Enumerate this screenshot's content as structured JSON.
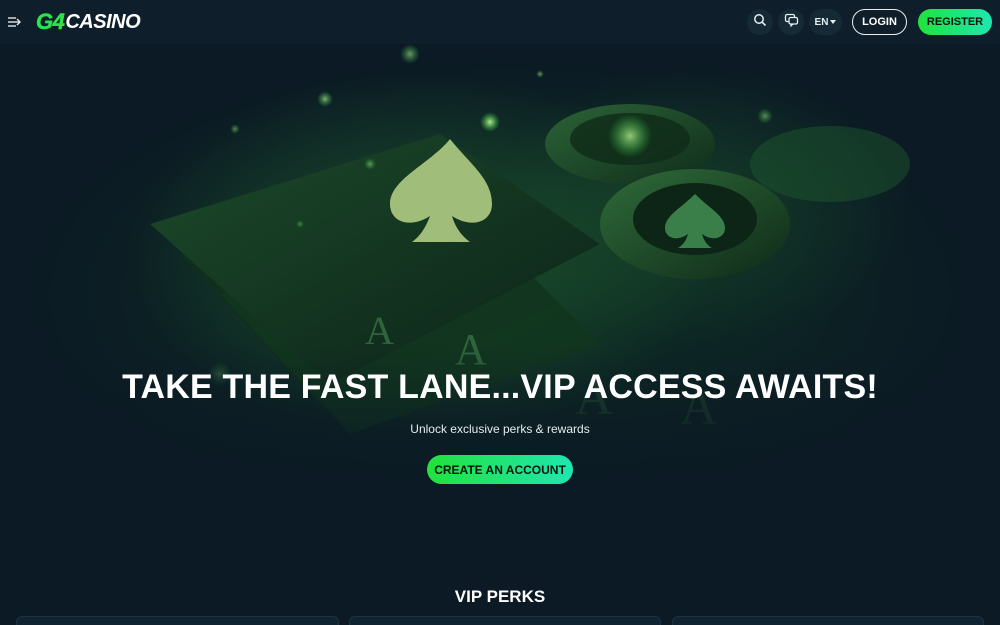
{
  "header": {
    "logo_mark": "G4",
    "logo_text": "CASINO",
    "icons": [
      "menu-toggle-icon",
      "search-icon",
      "chat-icon"
    ],
    "language": "EN",
    "login_label": "LOGIN",
    "register_label": "REGISTER"
  },
  "hero": {
    "title": "TAKE THE FAST LANE...VIP ACCESS AWAITS!",
    "subtitle": "Unlock exclusive perks & rewards",
    "cta_label": "CREATE AN ACCOUNT"
  },
  "perks": {
    "title": "VIP PERKS"
  },
  "colors": {
    "accent_green": "#22e23c",
    "accent_teal": "#1fe6b0",
    "background": "#0b1a24",
    "header_bg": "#0e1f2b"
  }
}
